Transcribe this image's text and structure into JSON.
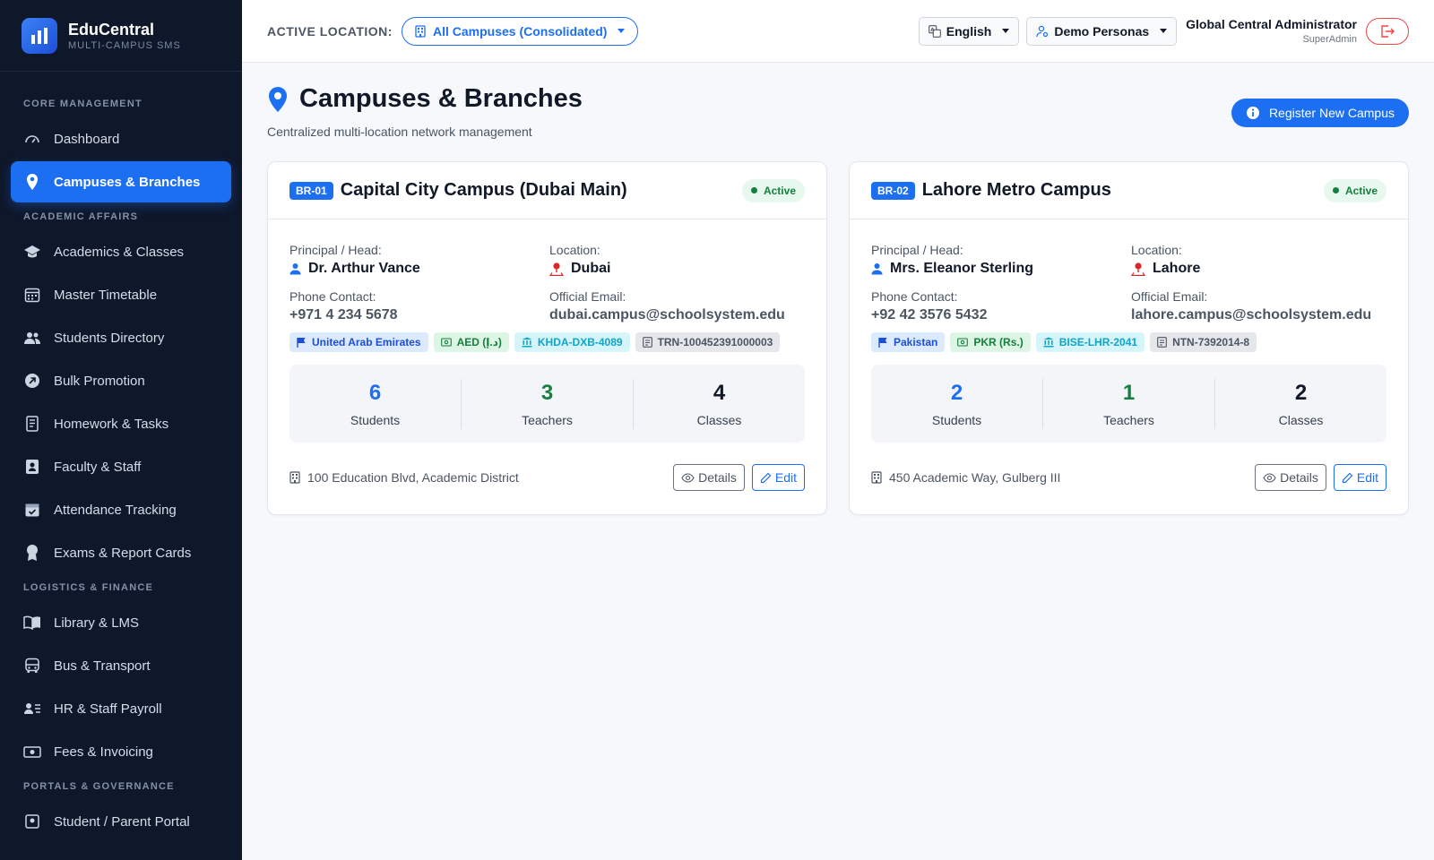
{
  "brand": {
    "name": "EduCentral",
    "subtitle": "MULTI-CAMPUS SMS"
  },
  "sidebar": {
    "sections": [
      {
        "title": "CORE MANAGEMENT",
        "items": [
          {
            "label": "Dashboard",
            "icon": "dashboard-gauge-icon"
          },
          {
            "label": "Campuses & Branches",
            "icon": "map-pin-icon",
            "active": true
          }
        ]
      },
      {
        "title": "ACADEMIC AFFAIRS",
        "items": [
          {
            "label": "Academics & Classes",
            "icon": "graduation-cap-icon"
          },
          {
            "label": "Master Timetable",
            "icon": "calendar-grid-icon"
          },
          {
            "label": "Students Directory",
            "icon": "people-icon"
          },
          {
            "label": "Bulk Promotion",
            "icon": "arrow-up-right-circle-icon"
          },
          {
            "label": "Homework & Tasks",
            "icon": "journal-icon"
          },
          {
            "label": "Faculty & Staff",
            "icon": "id-badge-icon"
          },
          {
            "label": "Attendance Tracking",
            "icon": "calendar-check-icon"
          },
          {
            "label": "Exams & Report Cards",
            "icon": "award-icon"
          }
        ]
      },
      {
        "title": "LOGISTICS & FINANCE",
        "items": [
          {
            "label": "Library & LMS",
            "icon": "book-icon"
          },
          {
            "label": "Bus & Transport",
            "icon": "bus-icon"
          },
          {
            "label": "HR & Staff Payroll",
            "icon": "person-lines-icon"
          },
          {
            "label": "Fees & Invoicing",
            "icon": "cash-icon"
          }
        ]
      },
      {
        "title": "PORTALS & GOVERNANCE",
        "items": [
          {
            "label": "Student / Parent Portal",
            "icon": "person-badge-icon"
          }
        ]
      }
    ]
  },
  "topbar": {
    "location_label": "ACTIVE LOCATION:",
    "location_value": "All Campuses (Consolidated)",
    "language": "English",
    "personas": "Demo Personas",
    "user_name": "Global Central Administrator",
    "user_role": "SuperAdmin"
  },
  "page": {
    "title": "Campuses & Branches",
    "subtitle": "Centralized multi-location network management",
    "register_button": "Register New Campus"
  },
  "labels": {
    "principal": "Principal / Head:",
    "location": "Location:",
    "phone": "Phone Contact:",
    "email": "Official Email:",
    "students": "Students",
    "teachers": "Teachers",
    "classes": "Classes",
    "details": "Details",
    "edit": "Edit"
  },
  "campuses": [
    {
      "code": "BR-01",
      "name": "Capital City Campus (Dubai Main)",
      "status": "Active",
      "principal": "Dr. Arthur Vance",
      "location": "Dubai",
      "phone": "+971 4 234 5678",
      "email": "dubai.campus@schoolsystem.edu",
      "tags": [
        {
          "text": "United Arab Emirates",
          "style": "blue",
          "icon": "flag-icon"
        },
        {
          "text": "AED (د.إ)",
          "style": "green",
          "icon": "currency-icon"
        },
        {
          "text": "KHDA-DXB-4089",
          "style": "cyan",
          "icon": "bank-icon"
        },
        {
          "text": "TRN-100452391000003",
          "style": "gray",
          "icon": "receipt-icon"
        }
      ],
      "students": "6",
      "teachers": "3",
      "classes": "4",
      "address": "100 Education Blvd, Academic District"
    },
    {
      "code": "BR-02",
      "name": "Lahore Metro Campus",
      "status": "Active",
      "principal": "Mrs. Eleanor Sterling",
      "location": "Lahore",
      "phone": "+92 42 3576 5432",
      "email": "lahore.campus@schoolsystem.edu",
      "tags": [
        {
          "text": "Pakistan",
          "style": "blue",
          "icon": "flag-icon"
        },
        {
          "text": "PKR (Rs.)",
          "style": "green",
          "icon": "currency-icon"
        },
        {
          "text": "BISE-LHR-2041",
          "style": "cyan",
          "icon": "bank-icon"
        },
        {
          "text": "NTN-7392014-8",
          "style": "gray",
          "icon": "receipt-icon"
        }
      ],
      "students": "2",
      "teachers": "1",
      "classes": "2",
      "address": "450 Academic Way, Gulberg III"
    }
  ],
  "colors": {
    "primary": "#1d6ff2",
    "sidebar_bg": "#0f172a",
    "students_num": "#1d6ff2",
    "teachers_num": "#15803d",
    "classes_num": "#111827",
    "status_green": "#15803d",
    "location_pin": "#dc2626"
  }
}
